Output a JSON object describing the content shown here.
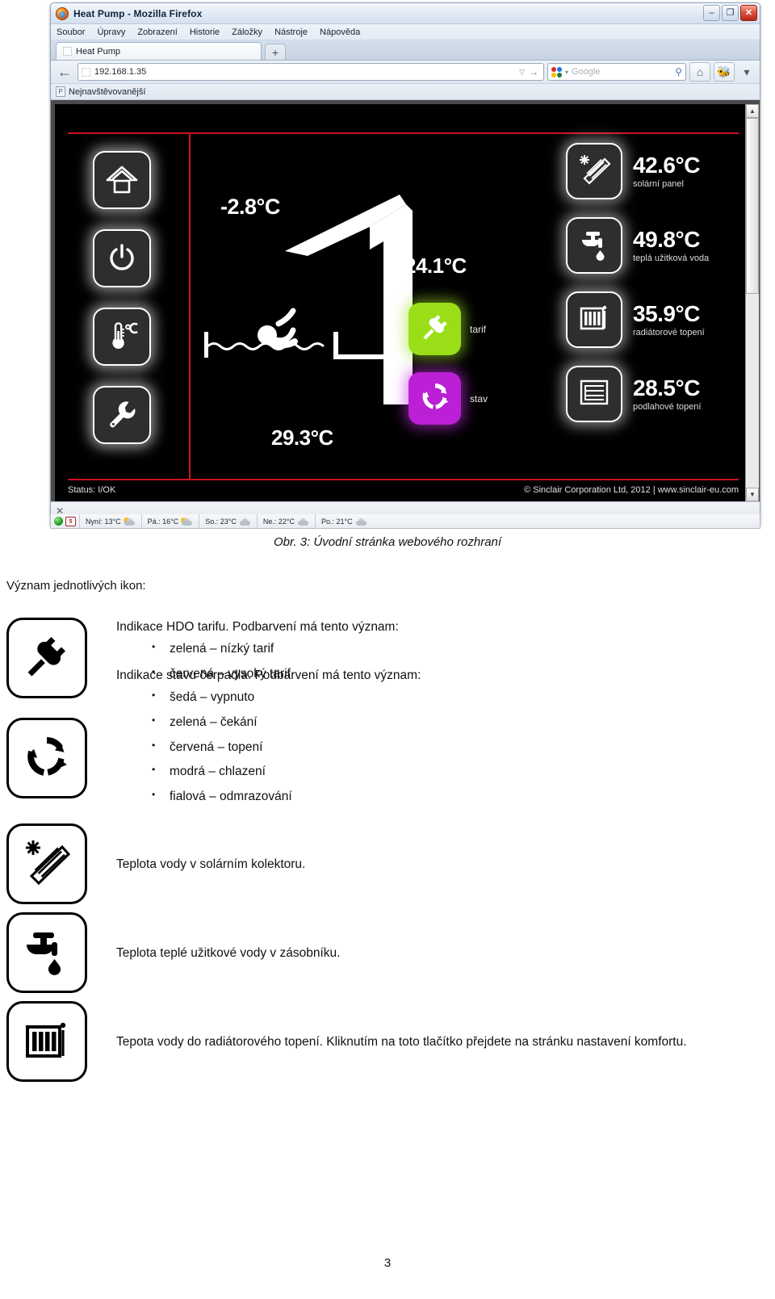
{
  "browser": {
    "title": "Heat Pump - Mozilla Firefox",
    "window_controls": {
      "minimize": "–",
      "maximize": "❐",
      "close": "✕"
    },
    "menus": [
      "Soubor",
      "Úpravy",
      "Zobrazení",
      "Historie",
      "Záložky",
      "Nástroje",
      "Nápověda"
    ],
    "tab_label": "Heat Pump",
    "newtab_label": "+",
    "back_arrow": "←",
    "url": "192.168.1.35",
    "url_dropdown": "▽",
    "url_go": "→",
    "search_placeholder": "Google",
    "search_caret": "▾",
    "search_magnifier": "⚲",
    "home_icon_label": "⌂",
    "addons_caret": "▾",
    "bookmark_label": "Nejnavštěvovanější",
    "bookmark_icon_letter": "P",
    "find_close": "✕",
    "scroll_up": "▲",
    "scroll_down": "▼"
  },
  "webapp": {
    "rail_icons": [
      {
        "name": "home-icon",
        "label": "Home"
      },
      {
        "name": "power-icon",
        "label": "Power"
      },
      {
        "name": "temperature-icon",
        "label": "Temperature"
      },
      {
        "name": "settings-wrench-icon",
        "label": "Settings"
      }
    ],
    "outdoor_temp": "-2.8°C",
    "indoor_temp": "24.1°C",
    "pool_temp": "29.3°C",
    "tiles": [
      {
        "label": "tarif",
        "color": "#9ade17",
        "icon": "plug-icon"
      },
      {
        "label": "stav",
        "color": "#bb1fd6",
        "icon": "recycle-arrows-icon"
      }
    ],
    "readings": [
      {
        "value": "42.6°C",
        "caption": "solární panel",
        "icon": "solar-panel-icon"
      },
      {
        "value": "49.8°C",
        "caption": "teplá užitková voda",
        "icon": "faucet-icon"
      },
      {
        "value": "35.9°C",
        "caption": "radiátorové topení",
        "icon": "radiator-icon"
      },
      {
        "value": "28.5°C",
        "caption": "podlahové topení",
        "icon": "floor-heating-icon"
      }
    ],
    "status": "Status: I/OK",
    "copyright": "© Sinclair Corporation Ltd, 2012 | www.sinclair-eu.com"
  },
  "weatherbar": {
    "calendar_day": "5",
    "items": [
      {
        "label": "Nyní: 13°C",
        "icon": "sun-cloud-icon"
      },
      {
        "label": "Pá.: 16°C",
        "icon": "sun-cloud-icon"
      },
      {
        "label": "So.: 23°C",
        "icon": "cloud-icon"
      },
      {
        "label": "Ne.: 22°C",
        "icon": "cloud-icon"
      },
      {
        "label": "Po.: 21°C",
        "icon": "cloud-icon"
      }
    ]
  },
  "document": {
    "figure_caption": "Obr. 3: Úvodní stránka webového rozhraní",
    "section_title": "Význam jednotlivých ikon:",
    "page_number": "3",
    "rows": [
      {
        "icon": "plug-icon",
        "lead": "Indikace HDO tarifu. Podbarvení má tento význam:",
        "bullets": [
          "zelená – nízký tarif",
          "červená – vysoký tarif"
        ]
      },
      {
        "icon": "recycle-arrows-icon",
        "lead": "Indikace stavu čerpadla. Podbarvení má tento význam:",
        "bullets": [
          "šedá – vypnuto",
          "zelená – čekání",
          "červená – topení",
          "modrá – chlazení",
          "fialová – odmrazování"
        ]
      },
      {
        "icon": "solar-panel-icon",
        "lead": "Teplota vody v solárním kolektoru.",
        "bullets": []
      },
      {
        "icon": "faucet-icon",
        "lead": "Teplota teplé užitkové vody v zásobníku.",
        "bullets": []
      },
      {
        "icon": "radiator-icon",
        "lead": "Tepota vody do radiátorového topení. Kliknutím na toto tlačítko přejdete na stránku nastavení komfortu.",
        "bullets": []
      }
    ]
  }
}
